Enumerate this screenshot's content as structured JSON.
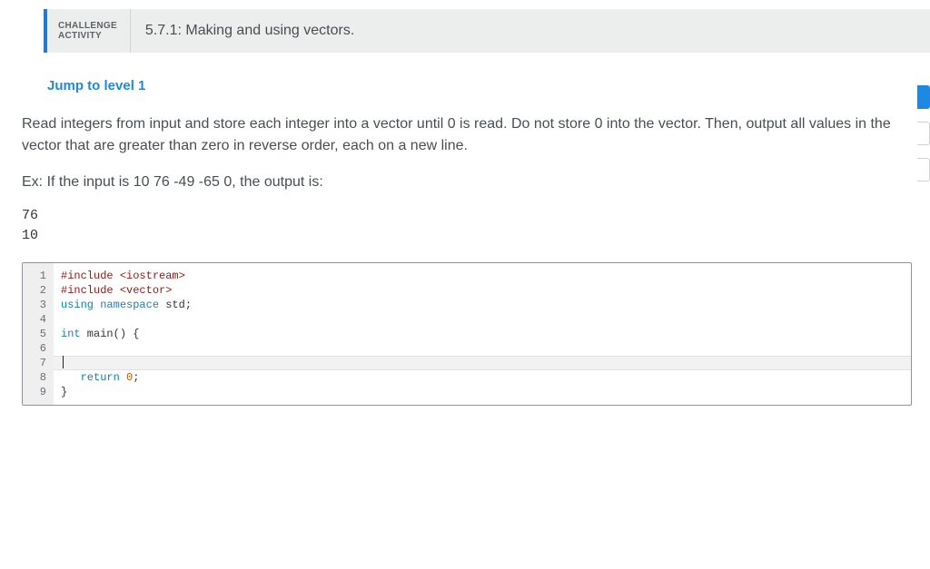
{
  "header": {
    "label1": "CHALLENGE",
    "label2": "ACTIVITY",
    "title": "5.7.1: Making and using vectors."
  },
  "jump_link": "Jump to level 1",
  "instruction": {
    "para1": "Read integers from input and store each integer into a vector until 0 is read. Do not store 0 into the vector. Then, output all values in the vector that are greater than zero in reverse order, each on a new line.",
    "example_intro": "Ex: If the input is 10 76 -49 -65 0, the output is:"
  },
  "output": {
    "line1": "76",
    "line2": "10"
  },
  "code": {
    "line_numbers": [
      "1",
      "2",
      "3",
      "4",
      "5",
      "6",
      "7",
      "8",
      "9"
    ],
    "l1_a": "#include ",
    "l1_b": "<iostream>",
    "l2_a": "#include ",
    "l2_b": "<vector>",
    "l3_a": "using",
    "l3_b": " namespace",
    "l3_c": " std",
    "l3_d": ";",
    "l4": "",
    "l5_a": "int",
    "l5_b": " main",
    "l5_c": "() {",
    "l6": "",
    "l7": "",
    "l8_a": "   return ",
    "l8_b": "0",
    "l8_c": ";",
    "l9": "}"
  }
}
